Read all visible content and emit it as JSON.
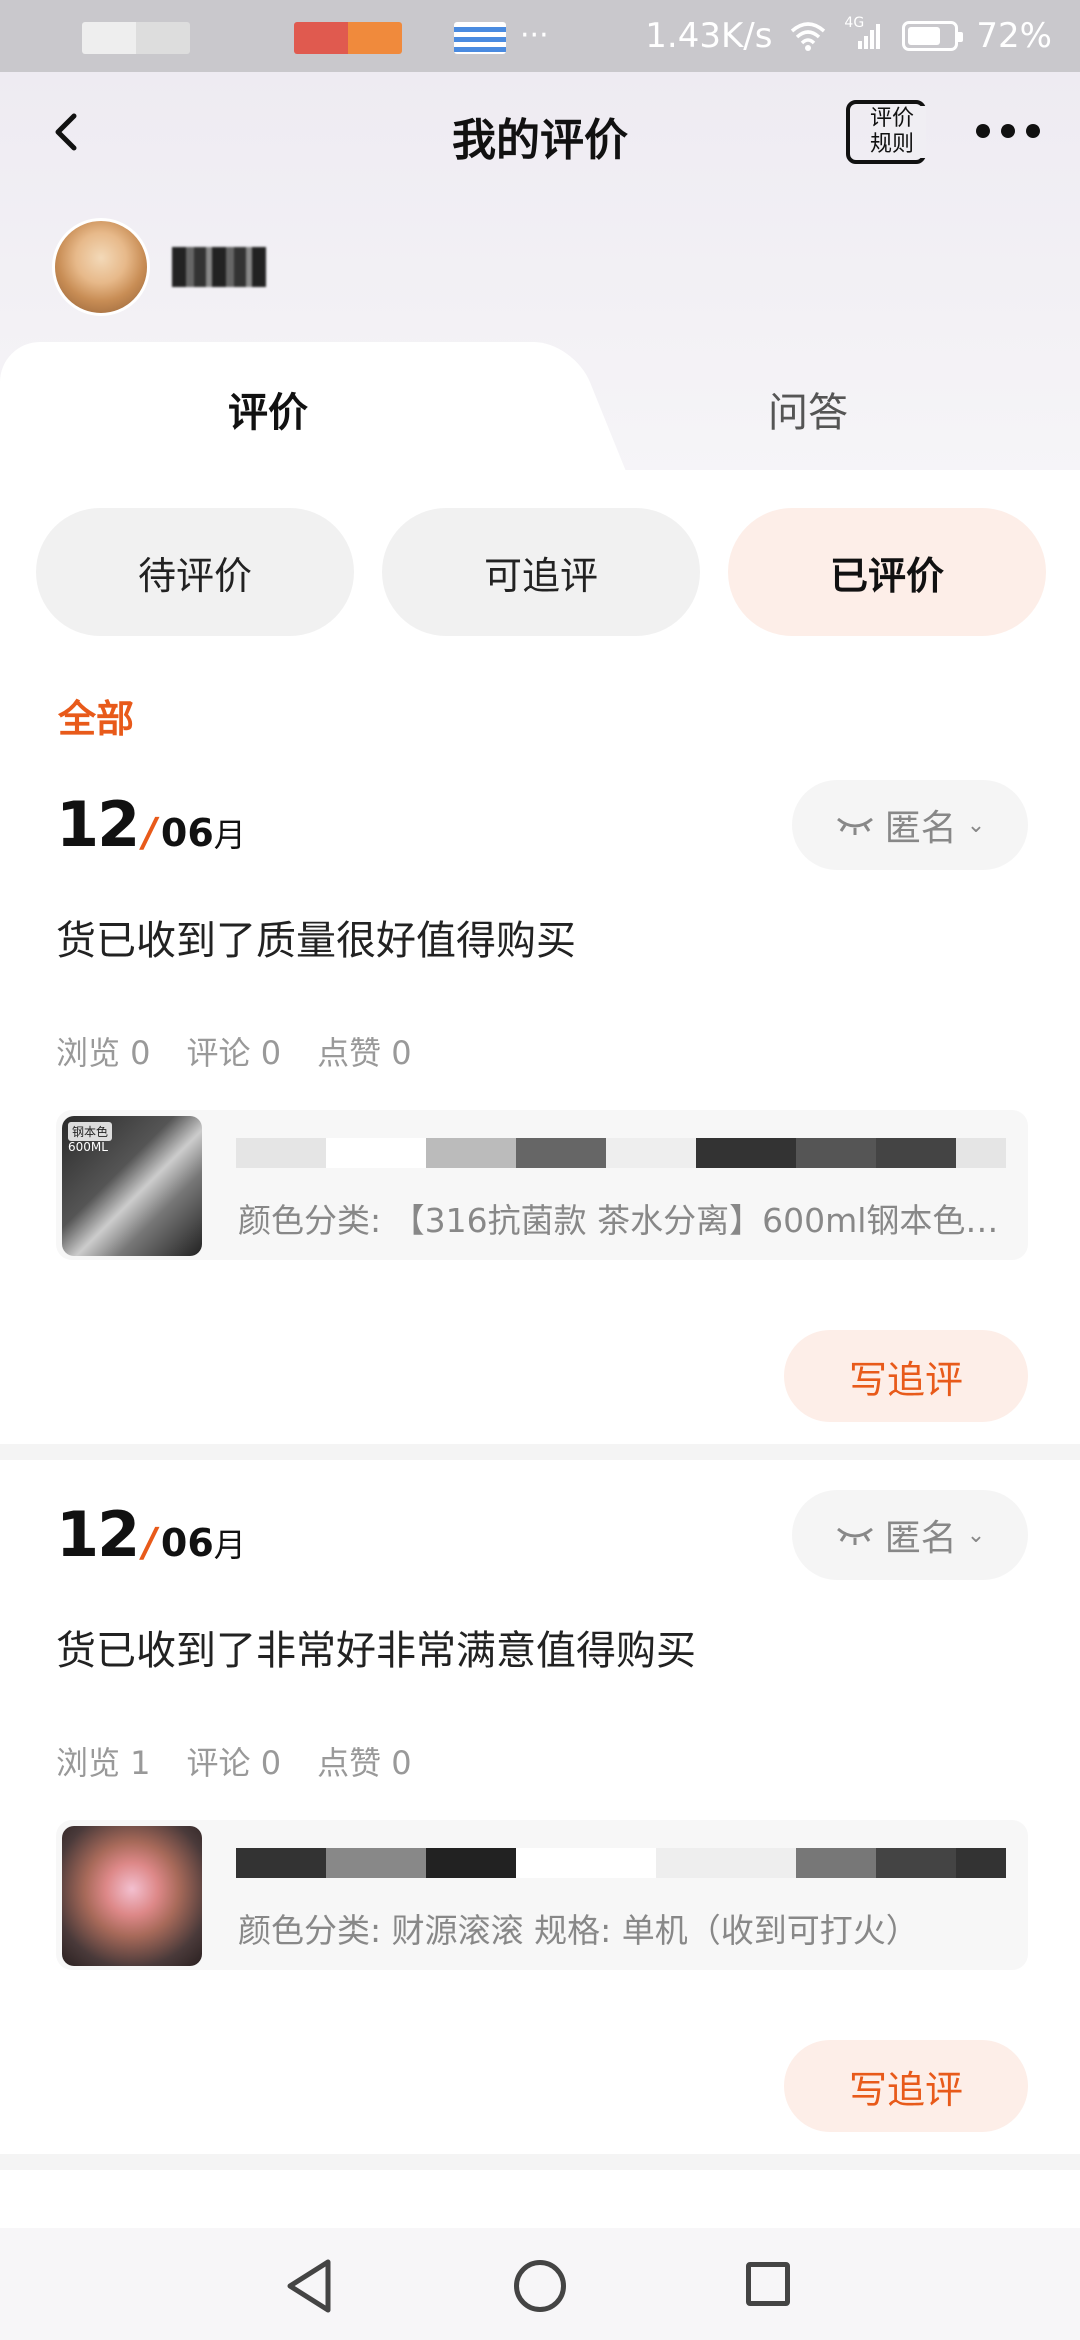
{
  "status_bar": {
    "speed": "1.43K/s",
    "network": "4G",
    "battery": "72%",
    "battery_level": 0.72,
    "more": "···"
  },
  "header": {
    "title": "我的评价",
    "rules_label": "评价规则",
    "rules_line1": "评价",
    "rules_line2": "规则"
  },
  "tabs": [
    {
      "label": "评价",
      "active": true
    },
    {
      "label": "问答",
      "active": false
    }
  ],
  "filters": [
    {
      "label": "待评价",
      "active": false
    },
    {
      "label": "可追评",
      "active": false
    },
    {
      "label": "已评价",
      "active": true
    }
  ],
  "section_label": "全部",
  "reviews": [
    {
      "day": "12",
      "month": "06",
      "month_unit": "月",
      "anon_label": "匿名",
      "text": "货已收到了质量很好值得购买",
      "stats": {
        "views": "浏览 0",
        "comments": "评论 0",
        "likes": "点赞 0"
      },
      "product_spec": "颜色分类: 【316抗菌款 茶水分离】600ml钢本色…",
      "thumb_caption_1": "钢本色",
      "thumb_caption_2": "600ML",
      "follow_label": "写追评"
    },
    {
      "day": "12",
      "month": "06",
      "month_unit": "月",
      "anon_label": "匿名",
      "text": "货已收到了非常好非常满意值得购买",
      "stats": {
        "views": "浏览 1",
        "comments": "评论 0",
        "likes": "点赞 0"
      },
      "product_spec": "颜色分类: 财源滚滚 规格: 单机（收到可打火）",
      "follow_label": "写追评"
    }
  ],
  "colors": {
    "accent": "#e85a1a",
    "accent_bg": "#fdeee8"
  }
}
